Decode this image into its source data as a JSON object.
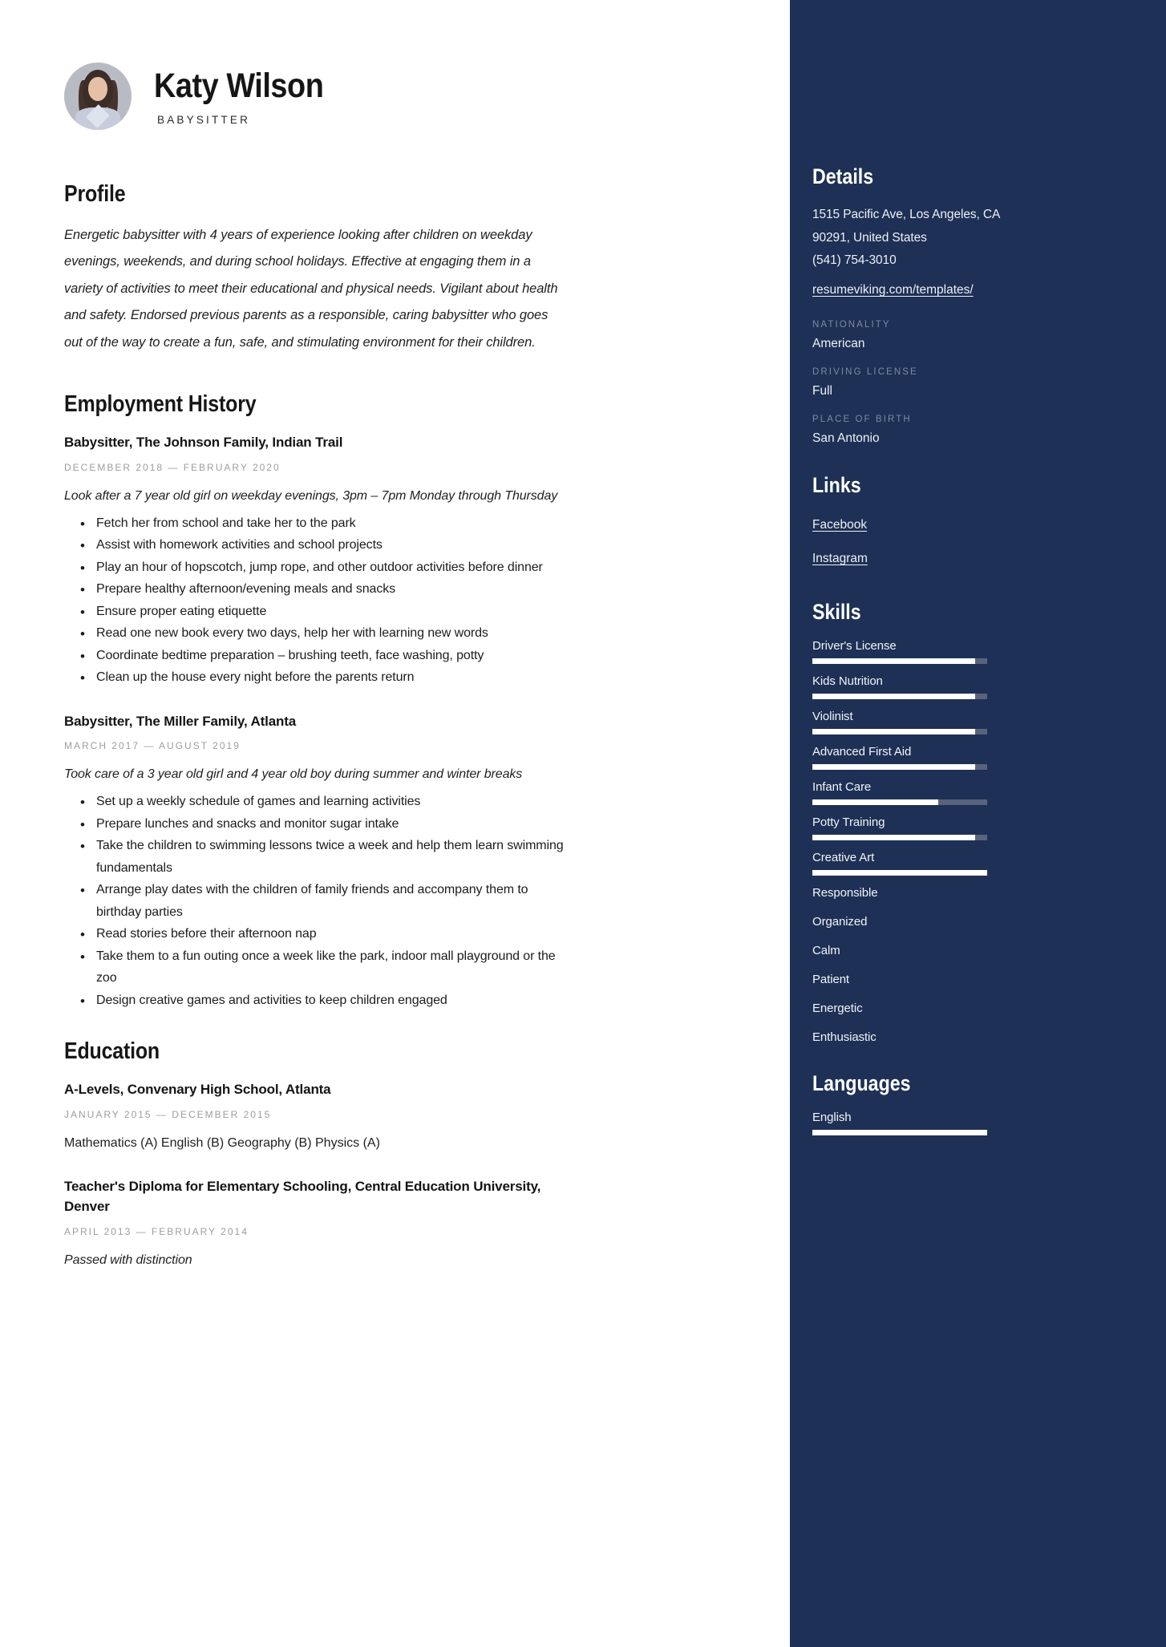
{
  "header": {
    "name": "Katy Wilson",
    "job_title": "BABYSITTER",
    "avatar_alt": "profile-photo"
  },
  "profile": {
    "heading": "Profile",
    "text": "Energetic babysitter with 4 years of experience looking after children on weekday evenings, weekends, and during school holidays. Effective at engaging them in a variety of activities to meet their educational and physical needs. Vigilant about health and safety. Endorsed previous parents as a responsible, caring babysitter who goes out of the way to create a fun, safe, and stimulating environment for their children."
  },
  "employment": {
    "heading": "Employment History",
    "entries": [
      {
        "title": "Babysitter, The Johnson Family, Indian Trail",
        "date": "DECEMBER 2018 — FEBRUARY 2020",
        "description": "Look after a 7 year old girl on weekday evenings, 3pm – 7pm Monday through Thursday",
        "bullets": [
          "Fetch her from school and take her to the park",
          "Assist with homework activities and school projects",
          "Play an hour of hopscotch, jump rope, and other outdoor activities before dinner",
          "Prepare healthy afternoon/evening meals and snacks",
          "Ensure proper eating etiquette",
          "Read one new book every two days, help her with learning new words",
          "Coordinate bedtime preparation – brushing teeth, face washing, potty",
          "Clean up the house every night before the parents return"
        ]
      },
      {
        "title": "Babysitter, The Miller Family, Atlanta",
        "date": "MARCH 2017 — AUGUST 2019",
        "description": "Took care of a 3 year old girl and 4 year old boy during summer and winter breaks",
        "bullets": [
          "Set up a weekly schedule of games and learning activities",
          "Prepare lunches and snacks and monitor sugar intake",
          "Take the children to swimming lessons twice a week and help them learn swimming fundamentals",
          "Arrange play dates with the children of family friends and accompany them to birthday parties",
          "Read stories before their afternoon nap",
          "Take them to a fun outing once a week like the park, indoor mall playground or the zoo",
          "Design creative games and activities to keep children engaged"
        ]
      }
    ]
  },
  "education": {
    "heading": "Education",
    "entries": [
      {
        "title": "A-Levels, Convenary High School, Atlanta",
        "date": "JANUARY 2015 — DECEMBER 2015",
        "description": "Mathematics (A) English (B) Geography (B) Physics (A)",
        "italic": false
      },
      {
        "title": "Teacher's Diploma for Elementary Schooling, Central Education University, Denver",
        "date": "APRIL 2013 — FEBRUARY 2014",
        "description": "Passed with distinction",
        "italic": true
      }
    ]
  },
  "sidebar": {
    "details": {
      "heading": "Details",
      "address_line1": "1515 Pacific Ave, Los Angeles, CA",
      "address_line2": "90291, United States",
      "phone": "(541) 754-3010",
      "website": "resumeviking.com/templates/",
      "fields": [
        {
          "label": "NATIONALITY",
          "value": "American"
        },
        {
          "label": "DRIVING LICENSE",
          "value": "Full"
        },
        {
          "label": "PLACE OF BIRTH",
          "value": "San Antonio"
        }
      ]
    },
    "links": {
      "heading": "Links",
      "items": [
        "Facebook",
        "Instagram"
      ]
    },
    "skills": {
      "heading": "Skills",
      "items": [
        {
          "name": "Driver's License",
          "level": 93,
          "has_bar": true
        },
        {
          "name": "Kids Nutrition",
          "level": 93,
          "has_bar": true
        },
        {
          "name": "Violinist",
          "level": 93,
          "has_bar": true
        },
        {
          "name": "Advanced First Aid",
          "level": 93,
          "has_bar": true
        },
        {
          "name": "Infant Care",
          "level": 72,
          "has_bar": true
        },
        {
          "name": "Potty Training",
          "level": 93,
          "has_bar": true
        },
        {
          "name": "Creative Art",
          "level": 100,
          "has_bar": true
        },
        {
          "name": "Responsible",
          "level": 0,
          "has_bar": false
        },
        {
          "name": "Organized",
          "level": 0,
          "has_bar": false
        },
        {
          "name": "Calm",
          "level": 0,
          "has_bar": false
        },
        {
          "name": "Patient",
          "level": 0,
          "has_bar": false
        },
        {
          "name": "Energetic",
          "level": 0,
          "has_bar": false
        },
        {
          "name": "Enthusiastic",
          "level": 0,
          "has_bar": false
        }
      ]
    },
    "languages": {
      "heading": "Languages",
      "items": [
        {
          "name": "English",
          "level": 100,
          "has_bar": true
        }
      ]
    }
  },
  "colors": {
    "sidebar_bg": "#1e3055",
    "accent_text": "#ffffff",
    "muted_label": "#7d8aa3",
    "date_gray": "#9d9d9d",
    "track": "#59637d"
  }
}
